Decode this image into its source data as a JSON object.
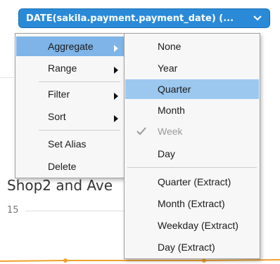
{
  "field_pill": {
    "label": "DATE(sakila.payment.payment_date) (...",
    "caret_icon": "chevron-down-icon"
  },
  "background": {
    "sheet_title_fragment": "Shop2 and Ave",
    "axis_label": "15"
  },
  "context_menu": {
    "items": [
      {
        "label": "Aggregate",
        "has_submenu": true,
        "highlighted": true
      },
      {
        "label": "Range",
        "has_submenu": true
      },
      {
        "label": "Filter",
        "has_submenu": true
      },
      {
        "label": "Sort",
        "has_submenu": true
      },
      {
        "label": "Set Alias",
        "has_submenu": false
      },
      {
        "label": "Delete",
        "has_submenu": false
      }
    ]
  },
  "aggregate_submenu": {
    "items": [
      {
        "label": "None"
      },
      {
        "label": "Year"
      },
      {
        "label": "Quarter",
        "highlighted": true
      },
      {
        "label": "Month"
      },
      {
        "label": "Week",
        "checked": true,
        "disabled": true
      },
      {
        "label": "Day"
      },
      {
        "label": "Quarter (Extract)"
      },
      {
        "label": "Month (Extract)"
      },
      {
        "label": "Weekday (Extract)"
      },
      {
        "label": "Day (Extract)"
      }
    ]
  },
  "colors": {
    "pill_bg": "#2a8ad8",
    "menu_highlight": "#7eb4e8",
    "submenu_highlight": "#9cc8ef",
    "line_series": "#f0a030"
  }
}
